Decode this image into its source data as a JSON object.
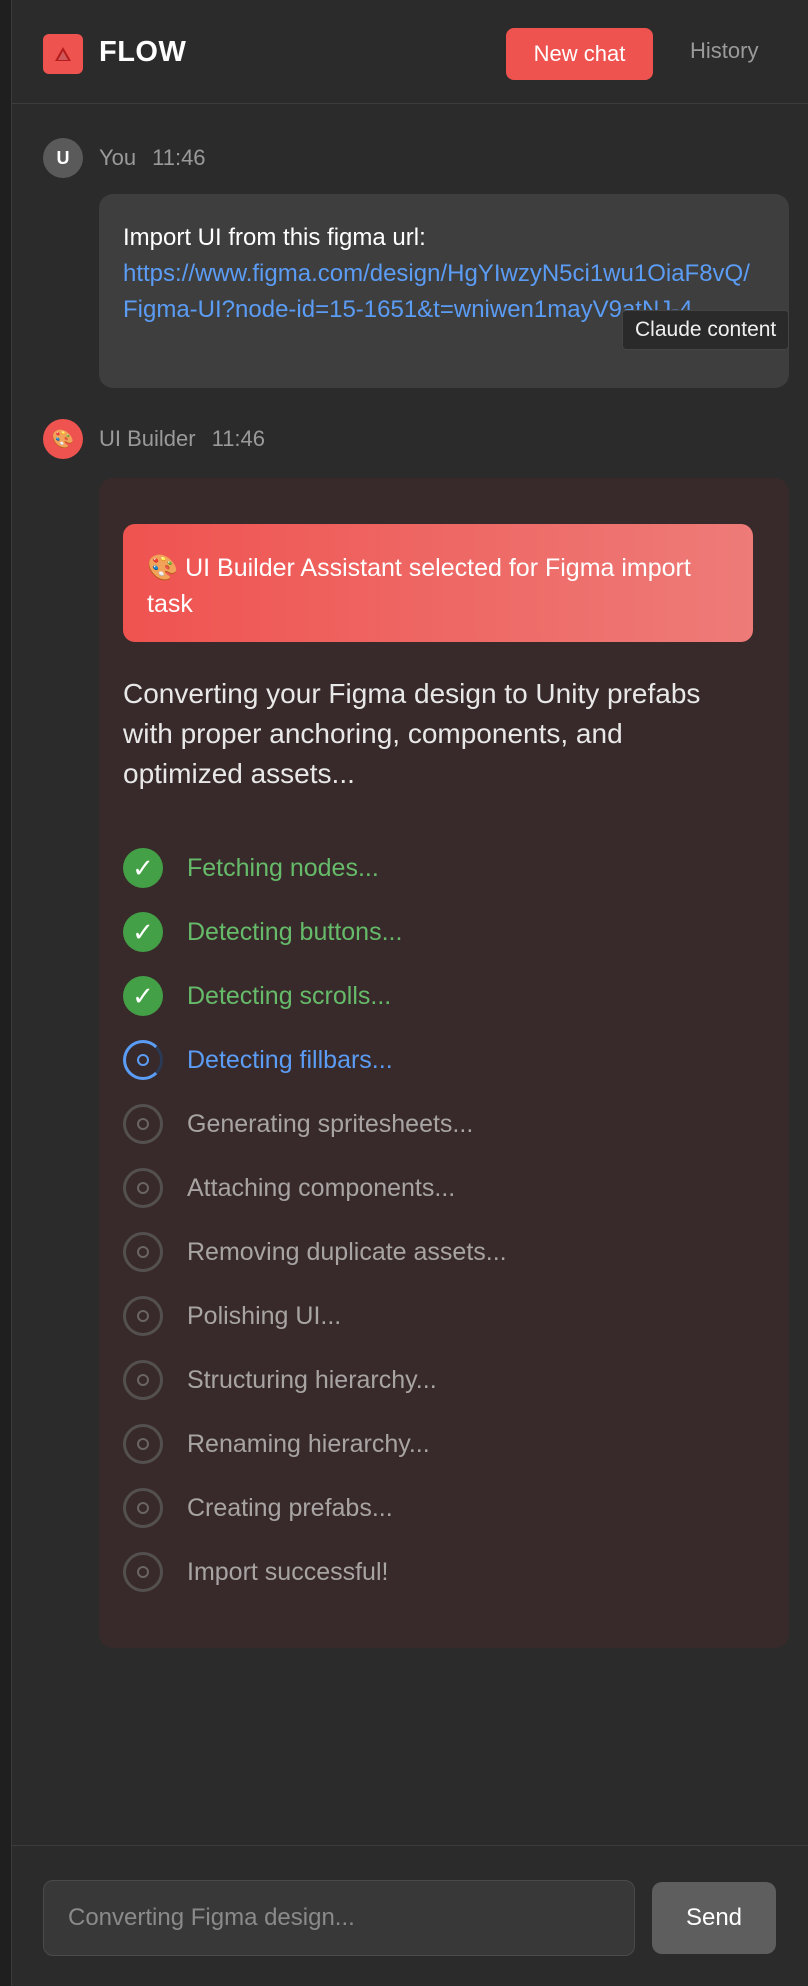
{
  "header": {
    "brand": "FLOW",
    "new_chat_label": "New chat",
    "history_label": "History"
  },
  "user_message": {
    "avatar": "U",
    "name": "You",
    "time": "11:46",
    "text": "Import UI from this figma url:",
    "link": "https://www.figma.com/design/HgYIwzyN5ci1wu1OiaF8vQ/Figma-UI?node-id=15-1651&t=wniwen1mayV9atNJ-4"
  },
  "tooltip": "Claude content",
  "bot_message": {
    "avatar": "🎨",
    "name": "UI Builder",
    "time": "11:46",
    "banner": "🎨 UI Builder Assistant selected for Figma import task",
    "intro": "Converting your Figma design to Unity prefabs with proper anchoring, components, and optimized assets...",
    "steps": [
      {
        "label": "Fetching nodes...",
        "status": "done"
      },
      {
        "label": "Detecting buttons...",
        "status": "done"
      },
      {
        "label": "Detecting scrolls...",
        "status": "done"
      },
      {
        "label": "Detecting fillbars...",
        "status": "active"
      },
      {
        "label": "Generating spritesheets...",
        "status": "pending"
      },
      {
        "label": "Attaching components...",
        "status": "pending"
      },
      {
        "label": "Removing duplicate assets...",
        "status": "pending"
      },
      {
        "label": "Polishing UI...",
        "status": "pending"
      },
      {
        "label": "Structuring hierarchy...",
        "status": "pending"
      },
      {
        "label": "Renaming hierarchy...",
        "status": "pending"
      },
      {
        "label": "Creating prefabs...",
        "status": "pending"
      },
      {
        "label": "Import successful!",
        "status": "pending"
      }
    ]
  },
  "composer": {
    "placeholder": "Converting Figma design...",
    "send_label": "Send"
  },
  "icons": {
    "logo": "flow-logo-icon",
    "done": "checkmark-icon",
    "active": "spinner-icon",
    "pending": "pending-circle-icon"
  },
  "colors": {
    "accent": "#ef5350",
    "link": "#5b9cf5",
    "success": "#66bb6a",
    "background": "#2b2b2b"
  }
}
